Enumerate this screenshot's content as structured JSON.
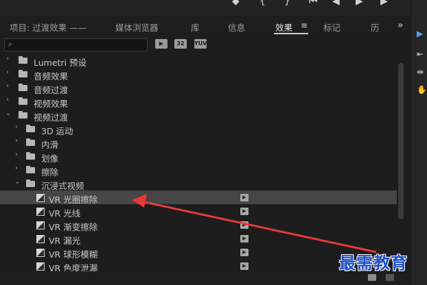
{
  "tabs": [
    {
      "label": "项目: 过渡效果 —— ",
      "active": false
    },
    {
      "label": "媒体浏览器",
      "active": false
    },
    {
      "label": "库",
      "active": false
    },
    {
      "label": "信息",
      "active": false
    },
    {
      "label": "效果",
      "active": true
    },
    {
      "label": "标记",
      "active": false
    },
    {
      "label": "历",
      "active": false
    }
  ],
  "tab_menu_icon": "≡",
  "more_tabs_icon": "»",
  "search": {
    "value": "",
    "placeholder": ""
  },
  "filter_buttons": [
    "accelerated-effects-icon",
    "32",
    "YUV"
  ],
  "tree": [
    {
      "label": "Lumetri 预设",
      "level": 0,
      "expanded": false,
      "type": "folder-star"
    },
    {
      "label": "音频效果",
      "level": 0,
      "expanded": false,
      "type": "folder"
    },
    {
      "label": "音频过渡",
      "level": 0,
      "expanded": false,
      "type": "folder"
    },
    {
      "label": "视频效果",
      "level": 0,
      "expanded": false,
      "type": "folder"
    },
    {
      "label": "视频过渡",
      "level": 0,
      "expanded": true,
      "type": "folder"
    },
    {
      "label": "3D 运动",
      "level": 1,
      "expanded": false,
      "type": "folder"
    },
    {
      "label": "内滑",
      "level": 1,
      "expanded": false,
      "type": "folder"
    },
    {
      "label": "划像",
      "level": 1,
      "expanded": false,
      "type": "folder"
    },
    {
      "label": "擦除",
      "level": 1,
      "expanded": false,
      "type": "folder"
    },
    {
      "label": "沉浸式视频",
      "level": 1,
      "expanded": true,
      "type": "folder"
    },
    {
      "label": "VR 光圈擦除",
      "level": 2,
      "type": "effect",
      "selected": true
    },
    {
      "label": "VR 光线",
      "level": 2,
      "type": "effect"
    },
    {
      "label": "VR 渐变擦除",
      "level": 2,
      "type": "effect"
    },
    {
      "label": "VR 漏光",
      "level": 2,
      "type": "effect"
    },
    {
      "label": "VR 球形模糊",
      "level": 2,
      "type": "effect"
    },
    {
      "label": "VR 色度泄漏",
      "level": 2,
      "type": "effect"
    }
  ],
  "watermark": "最需教育",
  "colors": {
    "accent": "#2e6fd8",
    "arrow": "#e83a3a",
    "watermark": "#1d4fc4"
  }
}
